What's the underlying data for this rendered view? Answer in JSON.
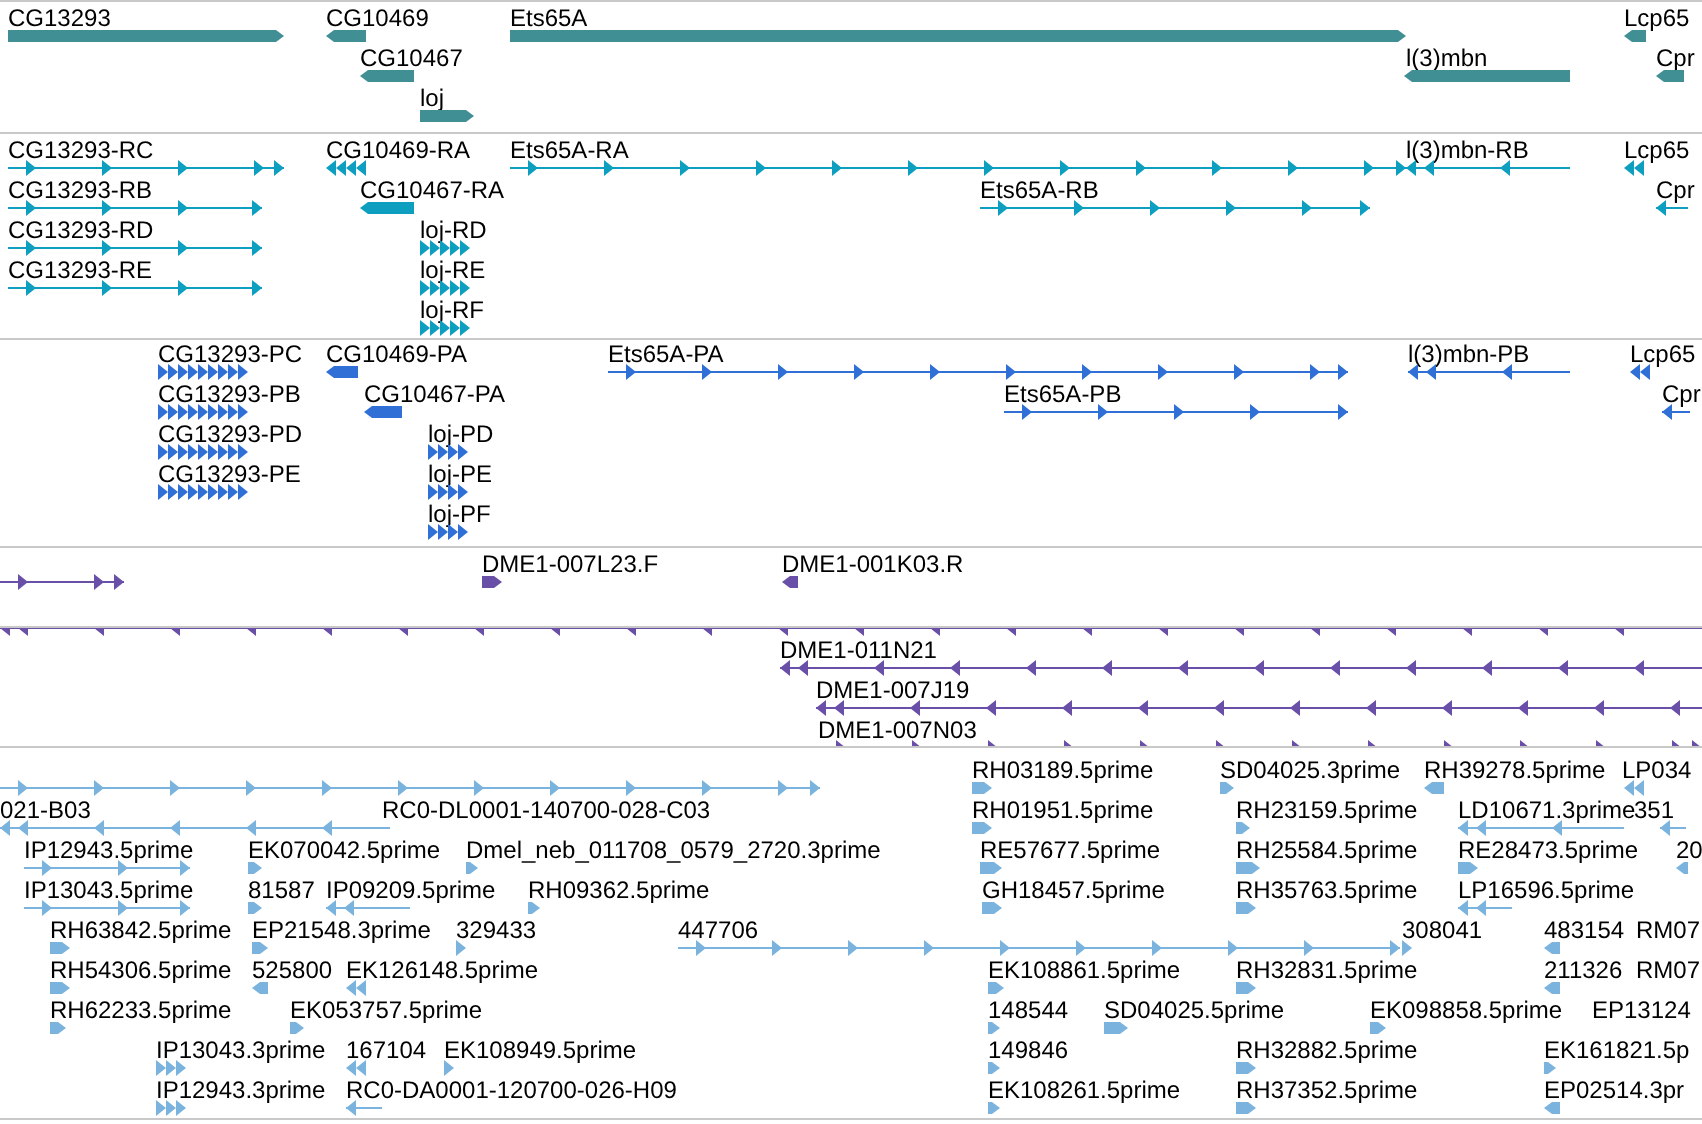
{
  "tracks": [
    {
      "color": "#3f8f94",
      "features": [
        {
          "label": "CG13293",
          "kind": "bar"
        },
        {
          "label": "CG10469",
          "kind": "bar"
        },
        {
          "label": "CG10467",
          "kind": "bar"
        },
        {
          "label": "loj",
          "kind": "bar"
        },
        {
          "label": "Ets65A",
          "kind": "bar"
        },
        {
          "label": "l(3)mbn",
          "kind": "bar"
        },
        {
          "label": "Lcp65",
          "kind": "bar"
        },
        {
          "label": "Cpr",
          "kind": "bar"
        }
      ]
    },
    {
      "color": "#0e9fc0",
      "features": [
        {
          "label": "CG13293-RC",
          "kind": "line"
        },
        {
          "label": "CG13293-RB",
          "kind": "line"
        },
        {
          "label": "CG13293-RD",
          "kind": "line"
        },
        {
          "label": "CG13293-RE",
          "kind": "line"
        },
        {
          "label": "CG10469-RA",
          "kind": "chevrons"
        },
        {
          "label": "CG10467-RA",
          "kind": "bar"
        },
        {
          "label": "loj-RD",
          "kind": "chevrons"
        },
        {
          "label": "loj-RE",
          "kind": "chevrons"
        },
        {
          "label": "loj-RF",
          "kind": "chevrons"
        },
        {
          "label": "Ets65A-RA",
          "kind": "line"
        },
        {
          "label": "Ets65A-RB",
          "kind": "line"
        },
        {
          "label": "l(3)mbn-RB",
          "kind": "line"
        },
        {
          "label": "Lcp65",
          "kind": "chevrons"
        },
        {
          "label": "Cpr",
          "kind": "line"
        }
      ]
    },
    {
      "color": "#2f6fd6",
      "features": [
        {
          "label": "CG13293-PC",
          "kind": "chevrons"
        },
        {
          "label": "CG13293-PB",
          "kind": "chevrons"
        },
        {
          "label": "CG13293-PD",
          "kind": "chevrons"
        },
        {
          "label": "CG13293-PE",
          "kind": "chevrons"
        },
        {
          "label": "CG10469-PA",
          "kind": "bar"
        },
        {
          "label": "CG10467-PA",
          "kind": "bar"
        },
        {
          "label": "loj-PD",
          "kind": "chevrons"
        },
        {
          "label": "loj-PE",
          "kind": "chevrons"
        },
        {
          "label": "loj-PF",
          "kind": "chevrons"
        },
        {
          "label": "Ets65A-PA",
          "kind": "line"
        },
        {
          "label": "Ets65A-PB",
          "kind": "line"
        },
        {
          "label": "l(3)mbn-PB",
          "kind": "line"
        },
        {
          "label": "Lcp65",
          "kind": "chevrons"
        },
        {
          "label": "Cpr",
          "kind": "line"
        }
      ]
    },
    {
      "color": "#6a4fa8",
      "features": [
        {
          "kind": "line"
        },
        {
          "label": "DME1-007L23.F",
          "kind": "bar"
        },
        {
          "label": "DME1-001K03.R",
          "kind": "bar"
        }
      ]
    },
    {
      "color": "#6a4fa8",
      "features": [
        {
          "kind": "line"
        },
        {
          "label": "DME1-011N21",
          "kind": "line"
        },
        {
          "label": "DME1-007J19",
          "kind": "line"
        },
        {
          "label": "DME1-007N03",
          "kind": "line"
        }
      ]
    },
    {
      "color": "#7ab3dd",
      "features": [
        {
          "kind": "line"
        },
        {
          "label": "RH03189.5prime",
          "kind": "bar"
        },
        {
          "label": "SD04025.3prime",
          "kind": "bar"
        },
        {
          "label": "RH39278.5prime",
          "kind": "bar"
        },
        {
          "label": "LP034",
          "kind": "chevrons"
        },
        {
          "label": "021-B03",
          "kind": "line"
        },
        {
          "label": "RC0-DL0001-140700-028-C03",
          "kind": "label"
        },
        {
          "label": "RH01951.5prime",
          "kind": "bar"
        },
        {
          "label": "RH23159.5prime",
          "kind": "bar"
        },
        {
          "label": "LD10671.3prime",
          "kind": "line"
        },
        {
          "label": "351",
          "kind": "line"
        },
        {
          "label": "IP12943.5prime",
          "kind": "line"
        },
        {
          "label": "EK070042.5prime",
          "kind": "bar"
        },
        {
          "label": "Dmel_neb_011708_0579_2720.3prime",
          "kind": "bar"
        },
        {
          "label": "RE57677.5prime",
          "kind": "bar"
        },
        {
          "label": "RH25584.5prime",
          "kind": "bar"
        },
        {
          "label": "RE28473.5prime",
          "kind": "bar"
        },
        {
          "label": "20",
          "kind": "bar"
        },
        {
          "label": "IP13043.5prime",
          "kind": "line"
        },
        {
          "label": "81587",
          "kind": "bar"
        },
        {
          "label": "IP09209.5prime",
          "kind": "line"
        },
        {
          "label": "RH09362.5prime",
          "kind": "bar"
        },
        {
          "label": "GH18457.5prime",
          "kind": "bar"
        },
        {
          "label": "RH35763.5prime",
          "kind": "bar"
        },
        {
          "label": "LP16596.5prime",
          "kind": "line"
        },
        {
          "label": "RH63842.5prime",
          "kind": "bar"
        },
        {
          "label": "EP21548.3prime",
          "kind": "bar"
        },
        {
          "label": "329433",
          "kind": "chevrons"
        },
        {
          "label": "447706",
          "kind": "line"
        },
        {
          "label": "308041",
          "kind": "chevrons"
        },
        {
          "label": "483154",
          "kind": "bar"
        },
        {
          "label": "RM07",
          "kind": "label"
        },
        {
          "label": "RH54306.5prime",
          "kind": "bar"
        },
        {
          "label": "525800",
          "kind": "bar"
        },
        {
          "label": "EK126148.5prime",
          "kind": "chevrons"
        },
        {
          "label": "EK108861.5prime",
          "kind": "bar"
        },
        {
          "label": "RH32831.5prime",
          "kind": "bar"
        },
        {
          "label": "211326",
          "kind": "bar"
        },
        {
          "label": "RM07",
          "kind": "label"
        },
        {
          "label": "RH62233.5prime",
          "kind": "bar"
        },
        {
          "label": "EK053757.5prime",
          "kind": "bar"
        },
        {
          "label": "148544",
          "kind": "bar"
        },
        {
          "label": "SD04025.5prime",
          "kind": "bar"
        },
        {
          "label": "EK098858.5prime",
          "kind": "bar"
        },
        {
          "label": "EP13124",
          "kind": "label"
        },
        {
          "label": "IP13043.3prime",
          "kind": "chevrons"
        },
        {
          "label": "167104",
          "kind": "chevrons"
        },
        {
          "label": "EK108949.5prime",
          "kind": "chevrons"
        },
        {
          "label": "149846",
          "kind": "bar"
        },
        {
          "label": "RH32882.5prime",
          "kind": "bar"
        },
        {
          "label": "EK161821.5p",
          "kind": "bar"
        },
        {
          "label": "IP12943.3prime",
          "kind": "chevrons"
        },
        {
          "label": "RC0-DA0001-120700-026-H09",
          "kind": "line"
        },
        {
          "label": "EK108261.5prime",
          "kind": "bar"
        },
        {
          "label": "RH37352.5prime",
          "kind": "bar"
        },
        {
          "label": "EP02514.3pr",
          "kind": "bar"
        }
      ]
    }
  ]
}
